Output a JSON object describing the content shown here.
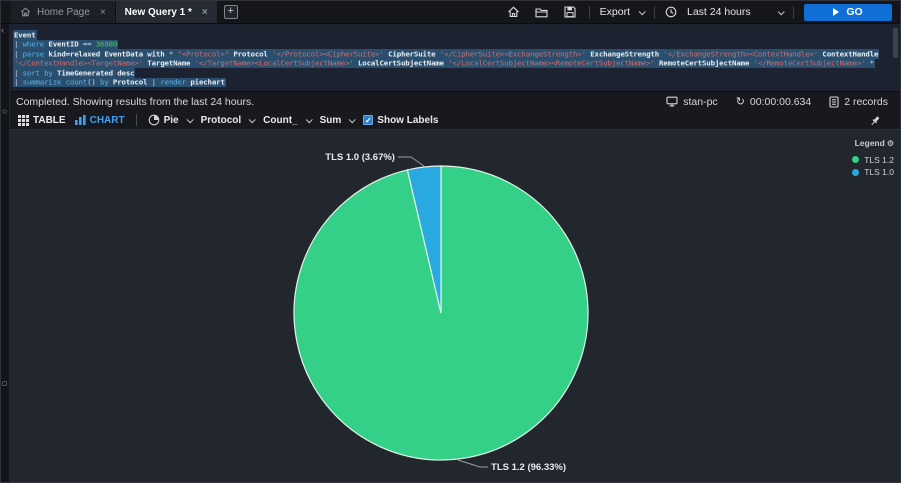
{
  "tabs": [
    {
      "label": "Home Page",
      "active": false
    },
    {
      "label": "New Query 1 *",
      "active": true
    }
  ],
  "topbar": {
    "export_label": "Export",
    "time_range": "Last 24 hours",
    "go_label": "GO"
  },
  "editor": {
    "lines": [
      {
        "segments": [
          {
            "t": "Event",
            "c": "i"
          }
        ]
      },
      {
        "segments": [
          {
            "t": "| ",
            "c": "p"
          },
          {
            "t": "where ",
            "c": "k"
          },
          {
            "t": "EventID ",
            "c": "i"
          },
          {
            "t": "== ",
            "c": "p"
          },
          {
            "t": "36880",
            "c": "n"
          }
        ]
      },
      {
        "segments": [
          {
            "t": "| ",
            "c": "p"
          },
          {
            "t": "parse ",
            "c": "k"
          },
          {
            "t": "kind=relaxed EventData with ",
            "c": "i"
          },
          {
            "t": "* ",
            "c": "p"
          },
          {
            "t": "\"<Protocol>\" ",
            "c": "s"
          },
          {
            "t": "Protocol ",
            "c": "i"
          },
          {
            "t": "'</Protocol><CipherSuite>' ",
            "c": "s"
          },
          {
            "t": "CipherSuite ",
            "c": "i"
          },
          {
            "t": "'</CipherSuite><ExchangeStrength>' ",
            "c": "s"
          },
          {
            "t": "ExchangeStrength ",
            "c": "i"
          },
          {
            "t": "'</ExchangeStrength><ContextHandle>' ",
            "c": "s"
          },
          {
            "t": "ContextHandle",
            "c": "i"
          }
        ]
      },
      {
        "segments": [
          {
            "t": "'</ContextHandle><TargetName>' ",
            "c": "s"
          },
          {
            "t": "TargetName ",
            "c": "i"
          },
          {
            "t": "'</TargetName><LocalCertSubjectName>' ",
            "c": "s"
          },
          {
            "t": "LocalCertSubjectName ",
            "c": "i"
          },
          {
            "t": "'</LocalCertSubjectName><RemoteCertSubjectName>' ",
            "c": "s"
          },
          {
            "t": "RemoteCertSubjectName ",
            "c": "i"
          },
          {
            "t": "'</RemoteCertSubjectName>' ",
            "c": "s"
          },
          {
            "t": "*",
            "c": "p"
          }
        ]
      },
      {
        "segments": [
          {
            "t": "| ",
            "c": "p"
          },
          {
            "t": "sort by ",
            "c": "k"
          },
          {
            "t": "TimeGenerated ",
            "c": "i"
          },
          {
            "t": "desc",
            "c": "i"
          }
        ]
      },
      {
        "segments": [
          {
            "t": "| ",
            "c": "p"
          },
          {
            "t": "summarize ",
            "c": "k"
          },
          {
            "t": "count",
            "c": "k"
          },
          {
            "t": "() ",
            "c": "p"
          },
          {
            "t": "by ",
            "c": "k"
          },
          {
            "t": "Protocol ",
            "c": "i"
          },
          {
            "t": "| ",
            "c": "p"
          },
          {
            "t": "render ",
            "c": "k"
          },
          {
            "t": "piechart",
            "c": "i"
          }
        ]
      }
    ]
  },
  "statusbar": {
    "message": "Completed. Showing results from the last 24 hours.",
    "machine": "stan-pc",
    "duration": "00:00:00.634",
    "records": "2 records"
  },
  "toolbar": {
    "table_label": "TABLE",
    "chart_label": "CHART",
    "chart_type": "Pie",
    "series_field": "Protocol",
    "value_field": "Count_",
    "aggregation": "Sum",
    "show_labels_label": "Show Labels",
    "checkmark": "✓"
  },
  "legend": {
    "title": "Legend",
    "items": [
      {
        "label": "TLS 1.2",
        "color": "#35d087"
      },
      {
        "label": "TLS 1.0",
        "color": "#28a9e0"
      }
    ]
  },
  "chart_data": {
    "type": "pie",
    "labels": [
      "TLS 1.2",
      "TLS 1.0"
    ],
    "values": [
      96.33,
      3.67
    ],
    "colors": [
      "#35d087",
      "#28a9e0"
    ],
    "slice_labels": [
      "TLS 1.2 (96.33%)",
      "TLS 1.0 (3.67%)"
    ],
    "legend_position": "top-right",
    "start_angle_deg": 0
  },
  "colors": {
    "accent_blue": "#0f6fd4",
    "selection": "#2a4f6e",
    "keyword": "#5cb1e8",
    "string": "#d16d6d",
    "number": "#4ecb51",
    "pie_green": "#35d087",
    "pie_blue": "#28a9e0"
  }
}
